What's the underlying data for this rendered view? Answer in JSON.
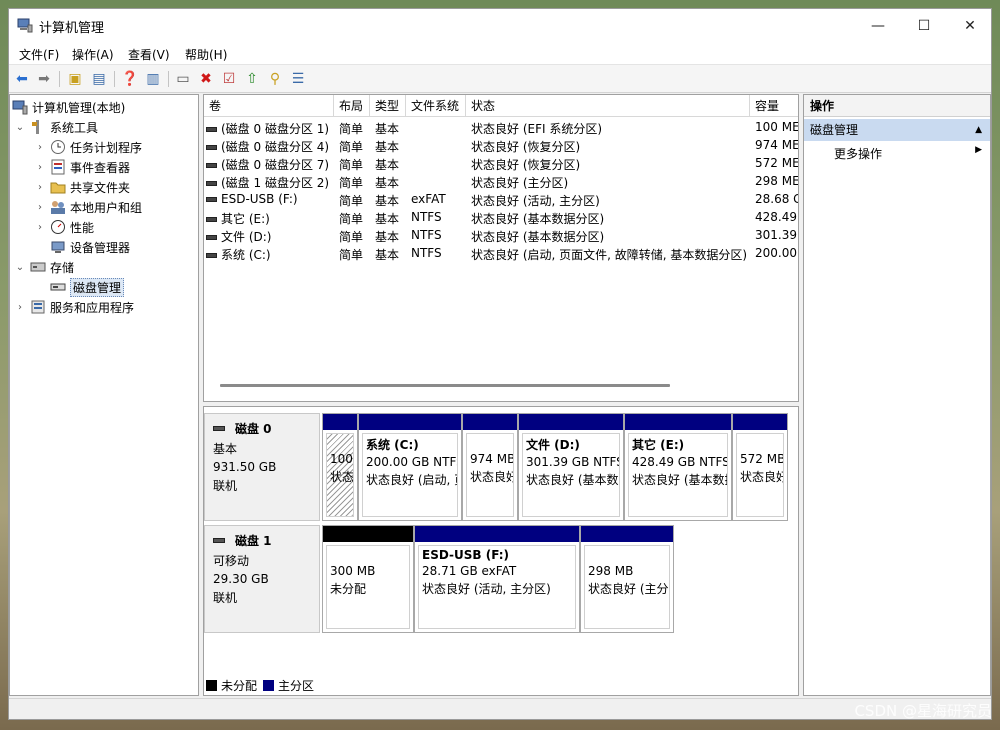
{
  "window": {
    "title": "计算机管理"
  },
  "menu": [
    "文件(F)",
    "操作(A)",
    "查看(V)",
    "帮助(H)"
  ],
  "tree": [
    {
      "label": "计算机管理(本地)",
      "level": 0,
      "chev": "",
      "icon": "computer-icon"
    },
    {
      "label": "系统工具",
      "level": 1,
      "chev": "⌄",
      "icon": "tools-icon"
    },
    {
      "label": "任务计划程序",
      "level": 2,
      "chev": "›",
      "icon": "clock-icon"
    },
    {
      "label": "事件查看器",
      "level": 2,
      "chev": "›",
      "icon": "event-viewer-icon"
    },
    {
      "label": "共享文件夹",
      "level": 2,
      "chev": "›",
      "icon": "shared-folder-icon"
    },
    {
      "label": "本地用户和组",
      "level": 2,
      "chev": "›",
      "icon": "users-icon"
    },
    {
      "label": "性能",
      "level": 2,
      "chev": "›",
      "icon": "performance-icon"
    },
    {
      "label": "设备管理器",
      "level": 2,
      "chev": "",
      "icon": "device-manager-icon"
    },
    {
      "label": "存储",
      "level": 1,
      "chev": "⌄",
      "icon": "storage-icon"
    },
    {
      "label": "磁盘管理",
      "level": 2,
      "chev": "",
      "icon": "disk-management-icon",
      "selected": true
    },
    {
      "label": "服务和应用程序",
      "level": 1,
      "chev": "›",
      "icon": "services-icon"
    }
  ],
  "volume_columns": [
    "卷",
    "布局",
    "类型",
    "文件系统",
    "状态",
    "容量"
  ],
  "volumes": [
    {
      "vol": "(磁盘 0 磁盘分区 1)",
      "layout": "简单",
      "type": "基本",
      "fs": "",
      "status": "状态良好 (EFI 系统分区)",
      "cap": "100 ME"
    },
    {
      "vol": "(磁盘 0 磁盘分区 4)",
      "layout": "简单",
      "type": "基本",
      "fs": "",
      "status": "状态良好 (恢复分区)",
      "cap": "974 ME"
    },
    {
      "vol": "(磁盘 0 磁盘分区 7)",
      "layout": "简单",
      "type": "基本",
      "fs": "",
      "status": "状态良好 (恢复分区)",
      "cap": "572 ME"
    },
    {
      "vol": "(磁盘 1 磁盘分区 2)",
      "layout": "简单",
      "type": "基本",
      "fs": "",
      "status": "状态良好 (主分区)",
      "cap": "298 ME"
    },
    {
      "vol": "ESD-USB (F:)",
      "layout": "简单",
      "type": "基本",
      "fs": "exFAT",
      "status": "状态良好 (活动, 主分区)",
      "cap": "28.68 G"
    },
    {
      "vol": "其它 (E:)",
      "layout": "简单",
      "type": "基本",
      "fs": "NTFS",
      "status": "状态良好 (基本数据分区)",
      "cap": "428.49"
    },
    {
      "vol": "文件 (D:)",
      "layout": "简单",
      "type": "基本",
      "fs": "NTFS",
      "status": "状态良好 (基本数据分区)",
      "cap": "301.39"
    },
    {
      "vol": "系统 (C:)",
      "layout": "简单",
      "type": "基本",
      "fs": "NTFS",
      "status": "状态良好 (启动, 页面文件, 故障转储, 基本数据分区)",
      "cap": "200.00"
    }
  ],
  "disks": [
    {
      "name": "磁盘 0",
      "kind": "基本",
      "size": "931.50 GB",
      "state": "联机",
      "partitions": [
        {
          "name": "",
          "l1": "100",
          "l2": "状态",
          "cap": "primary",
          "hatched": true
        },
        {
          "name": "系统 (C:)",
          "l1": "200.00 GB NTFS",
          "l2": "状态良好 (启动, 页",
          "cap": "primary"
        },
        {
          "name": "",
          "l1": "974 MB",
          "l2": "状态良好",
          "cap": "primary"
        },
        {
          "name": "文件 (D:)",
          "l1": "301.39 GB NTFS",
          "l2": "状态良好 (基本数",
          "cap": "primary"
        },
        {
          "name": "其它 (E:)",
          "l1": "428.49 GB NTFS",
          "l2": "状态良好 (基本数据",
          "cap": "primary"
        },
        {
          "name": "",
          "l1": "572 MB",
          "l2": "状态良好",
          "cap": "primary"
        }
      ]
    },
    {
      "name": "磁盘 1",
      "kind": "可移动",
      "size": "29.30 GB",
      "state": "联机",
      "partitions": [
        {
          "name": "",
          "l1": "300 MB",
          "l2": "未分配",
          "cap": "unalloc"
        },
        {
          "name": "ESD-USB (F:)",
          "l1": "28.71 GB exFAT",
          "l2": "状态良好 (活动, 主分区)",
          "cap": "primary"
        },
        {
          "name": "",
          "l1": "298 MB",
          "l2": "状态良好 (主分",
          "cap": "primary"
        }
      ]
    }
  ],
  "legend": [
    {
      "label": "未分配",
      "color": "#000000"
    },
    {
      "label": "主分区",
      "color": "#000080"
    }
  ],
  "actions": {
    "header": "操作",
    "group": "磁盘管理",
    "more": "更多操作"
  },
  "watermark": "CSDN @星海研究员"
}
